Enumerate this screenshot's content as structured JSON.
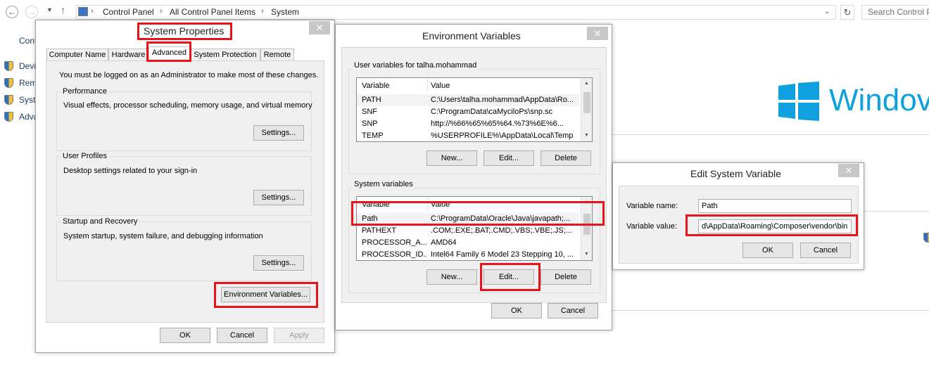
{
  "explorer": {
    "breadcrumbs": [
      "Control Panel",
      "All Control Panel Items",
      "System"
    ],
    "search_placeholder": "Search Control P",
    "cut_title": "Cont",
    "side_links": [
      "Devi",
      "Rem",
      "Syst",
      "Adva"
    ],
    "brand_text": "Windov"
  },
  "system_properties": {
    "title": "System Properties",
    "tabs": [
      "Computer Name",
      "Hardware",
      "Advanced",
      "System Protection",
      "Remote"
    ],
    "admin_note": "You must be logged on as an Administrator to make most of these changes.",
    "performance": {
      "title": "Performance",
      "desc": "Visual effects, processor scheduling, memory usage, and virtual memory",
      "button": "Settings..."
    },
    "user_profiles": {
      "title": "User Profiles",
      "desc": "Desktop settings related to your sign-in",
      "button": "Settings..."
    },
    "startup": {
      "title": "Startup and Recovery",
      "desc": "System startup, system failure, and debugging information",
      "button": "Settings..."
    },
    "env_button": "Environment Variables...",
    "ok": "OK",
    "cancel": "Cancel",
    "apply": "Apply"
  },
  "env_vars": {
    "title": "Environment Variables",
    "user_group": "User variables for talha.mohammad",
    "columns": [
      "Variable",
      "Value"
    ],
    "user_rows": [
      [
        "PATH",
        "C:\\Users\\talha.mohammad\\AppData\\Ro..."
      ],
      [
        "SNF",
        "C:\\ProgramData\\caMyciloPs\\snp.sc"
      ],
      [
        "SNP",
        "http://%66%65%65%64.%73%6E%6..."
      ],
      [
        "TEMP",
        "%USERPROFILE%\\AppData\\Local\\Temp"
      ]
    ],
    "system_group": "System variables",
    "system_rows": [
      [
        "Path",
        "C:\\ProgramData\\Oracle\\Java\\javapath;..."
      ],
      [
        "PATHEXT",
        ".COM;.EXE;.BAT;.CMD;.VBS;.VBE;.JS;..."
      ],
      [
        "PROCESSOR_A...",
        "AMD64"
      ],
      [
        "PROCESSOR_ID...",
        "Intel64 Family 6 Model 23 Stepping 10, ..."
      ]
    ],
    "new": "New...",
    "edit": "Edit...",
    "delete": "Delete",
    "ok": "OK",
    "cancel": "Cancel"
  },
  "edit_var": {
    "title": "Edit System Variable",
    "name_label": "Variable name:",
    "name_value": "Path",
    "value_label": "Variable value:",
    "value_value": "d\\AppData\\Roaming\\Composer\\vendor\\bin",
    "ok": "OK",
    "cancel": "Cancel"
  },
  "colors": {
    "highlight": "#e8141c",
    "windows_blue": "#10a0e0"
  }
}
